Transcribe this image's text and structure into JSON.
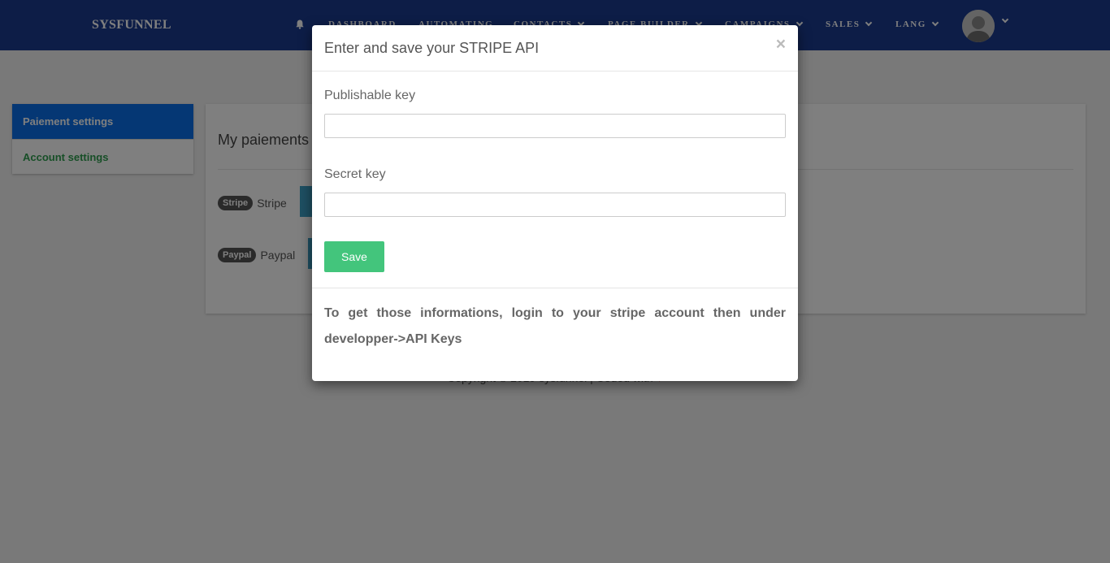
{
  "navbar": {
    "brand": "SYSFUNNEL",
    "items": [
      {
        "label": "DASHBOARD",
        "dropdown": false
      },
      {
        "label": "AUTOMATING",
        "dropdown": false
      },
      {
        "label": "CONTACTS",
        "dropdown": true
      },
      {
        "label": "PAGE BUILDER",
        "dropdown": true
      },
      {
        "label": "CAMPAIGNS",
        "dropdown": true
      },
      {
        "label": "SALES",
        "dropdown": true
      },
      {
        "label": "LANG",
        "dropdown": true
      }
    ],
    "bell_icon": "bell-icon",
    "avatar_icon": "user-avatar"
  },
  "sidebar": {
    "items": [
      {
        "label": "Paiement settings",
        "active": true
      },
      {
        "label": "Account settings",
        "active": false
      }
    ]
  },
  "main": {
    "title": "My paiements",
    "payments": [
      {
        "badge": "Stripe",
        "name": "Stripe"
      },
      {
        "badge": "Paypal",
        "name": "Paypal"
      }
    ]
  },
  "footer": {
    "text": "Copyright © 2019 sysfunnel | Coded with",
    "heart": "♥"
  },
  "modal": {
    "title": "Enter and save your STRIPE API",
    "close": "×",
    "publishable_label": "Publishable key",
    "publishable_value": "",
    "secret_label": "Secret key",
    "secret_value": "",
    "save_label": "Save",
    "note": "To get those informations, login to your stripe account then under developper->API Keys"
  },
  "colors": {
    "navbar": "#1a3a8f",
    "sidebar_active": "#0a6fe8",
    "sidebar_link": "#2e9e4f",
    "save_button": "#43c57c",
    "payment_button": "#3d9fc4"
  }
}
